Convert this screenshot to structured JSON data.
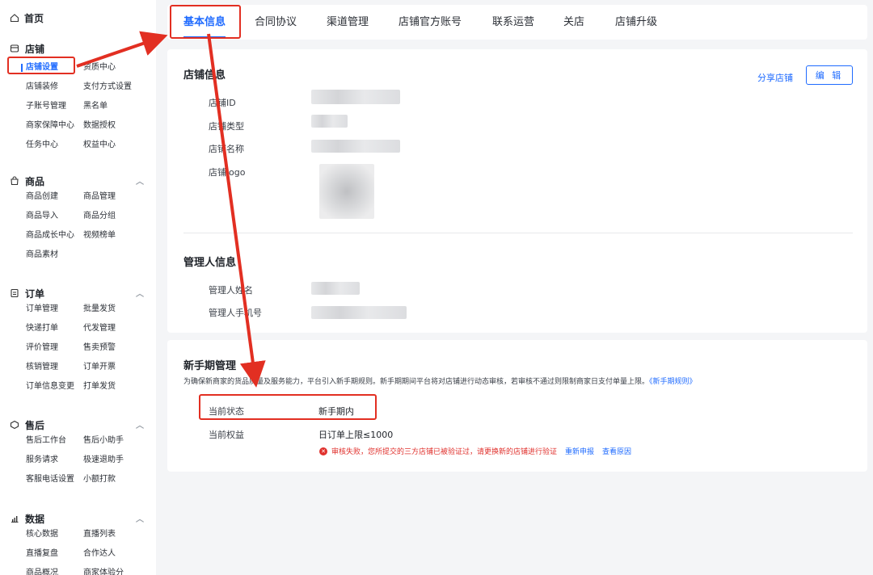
{
  "sidebar": {
    "home": "首页",
    "sections": [
      {
        "title": "店铺",
        "icon": "store-icon",
        "items": [
          "店铺设置",
          "资质中心",
          "店铺装修",
          "支付方式设置",
          "子账号管理",
          "黑名单",
          "商家保障中心",
          "数据授权",
          "任务中心",
          "权益中心"
        ]
      },
      {
        "title": "商品",
        "icon": "bag-icon",
        "items": [
          "商品创建",
          "商品管理",
          "商品导入",
          "商品分组",
          "商品成长中心",
          "视频榜单",
          "商品素材"
        ]
      },
      {
        "title": "订单",
        "icon": "order-icon",
        "items": [
          "订单管理",
          "批量发货",
          "快递打单",
          "代发管理",
          "评价管理",
          "售卖预警",
          "核销管理",
          "订单开票",
          "订单信息变更",
          "打单发货"
        ]
      },
      {
        "title": "售后",
        "icon": "aftersale-icon",
        "items": [
          "售后工作台",
          "售后小助手",
          "服务请求",
          "极速退助手",
          "客服电话设置",
          "小额打款"
        ]
      },
      {
        "title": "数据",
        "icon": "chart-icon",
        "items": [
          "核心数据",
          "直播列表",
          "直播复盘",
          "合作达人",
          "商品概况",
          "商家体验分"
        ]
      }
    ]
  },
  "tabs": [
    "基本信息",
    "合同协议",
    "渠道管理",
    "店铺官方账号",
    "联系运营",
    "关店",
    "店铺升级"
  ],
  "store_info": {
    "title": "店铺信息",
    "share": "分享店铺",
    "edit": "编 辑",
    "labels": [
      "店铺ID",
      "店铺类型",
      "店铺名称",
      "店铺logo"
    ]
  },
  "manager_info": {
    "title": "管理人信息",
    "labels": [
      "管理人姓名",
      "管理人手机号"
    ]
  },
  "newbie": {
    "title": "新手期管理",
    "desc": "为确保新商家的货品质量及服务能力，平台引入新手期规则。新手期期间平台将对店铺进行动态审核，若审核不通过则限制商家日支付单量上限。",
    "rule_link": "《新手期规则》",
    "status_label": "当前状态",
    "status_value": "新手期内",
    "rights_label": "当前权益",
    "rights_value": "日订单上限≤1000",
    "error_text": "审核失败，您所提交的三方店铺已被验证过，请更换新的店铺进行验证",
    "reapply": "重新申报",
    "view_reason": "查看原因"
  },
  "colors": {
    "accent": "#1f6bff",
    "error": "#e0312d",
    "highlight": "#e22f22"
  }
}
